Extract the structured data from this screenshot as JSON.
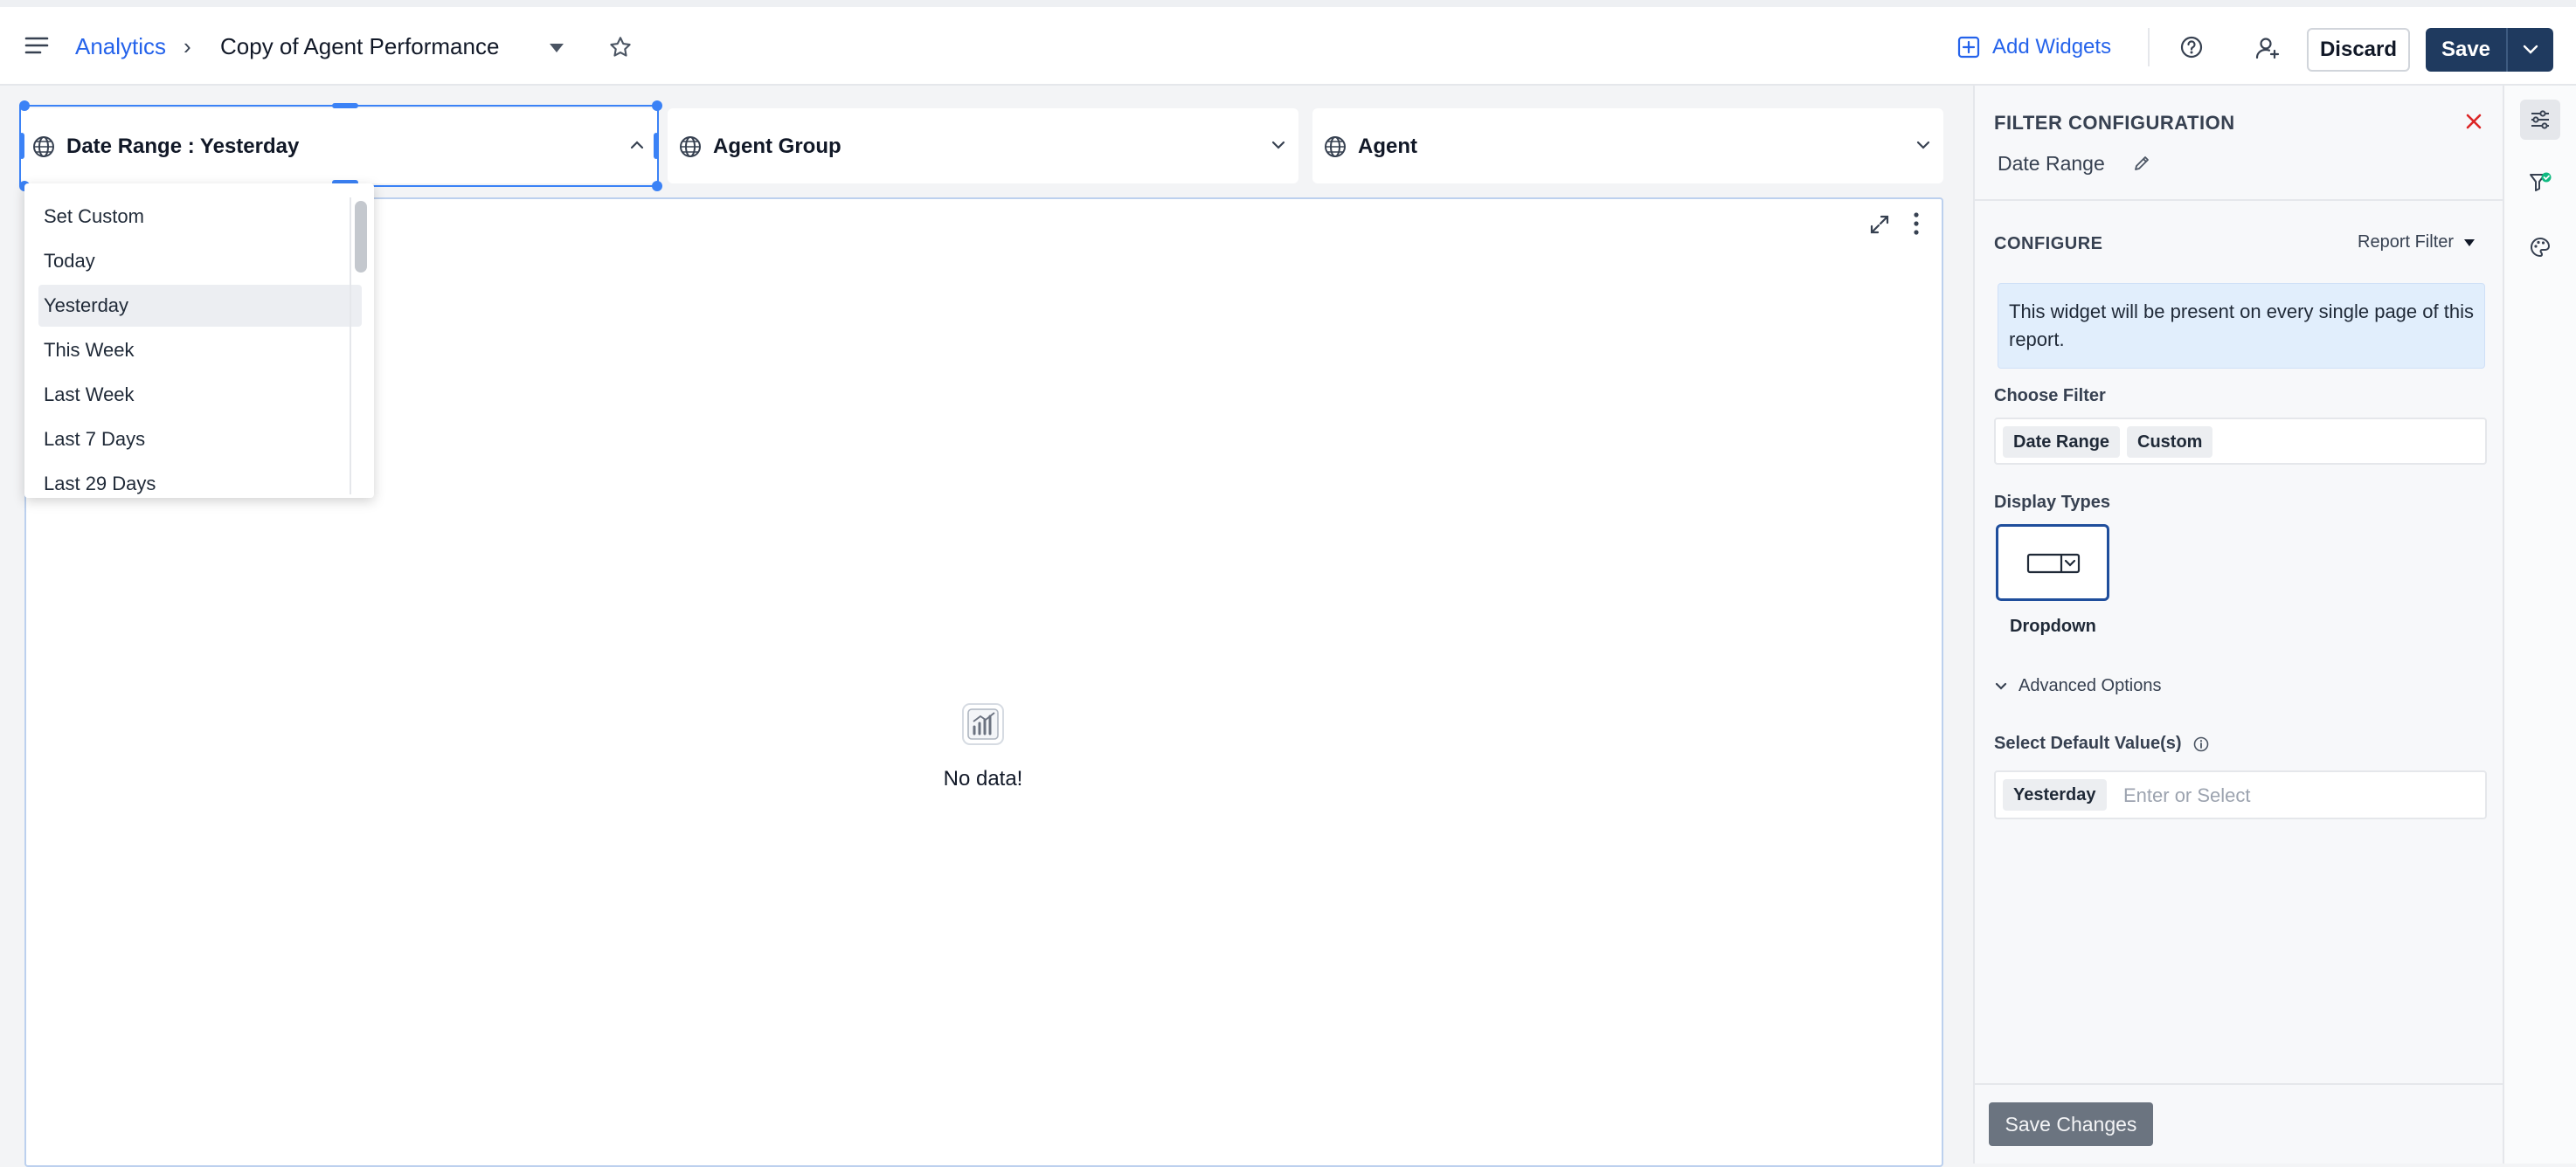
{
  "header": {
    "breadcrumb_root": "Analytics",
    "breadcrumb_separator": "›",
    "report_title": "Copy of Agent  Performance",
    "add_widgets_label": "Add Widgets",
    "discard_label": "Discard",
    "save_label": "Save"
  },
  "filters": [
    {
      "label": "Date Range :  Yesterday"
    },
    {
      "label": "Agent Group"
    },
    {
      "label": "Agent"
    }
  ],
  "date_dropdown": {
    "items": [
      "Set Custom",
      "Today",
      "Yesterday",
      "This Week",
      "Last Week",
      "Last 7 Days",
      "Last 29 Days"
    ],
    "selected": "Yesterday"
  },
  "widget": {
    "empty_text": "No data!"
  },
  "panel": {
    "title": "FILTER CONFIGURATION",
    "filter_name": "Date Range",
    "configure_label": "CONFIGURE",
    "scope_label": "Report Filter",
    "info_text": "This widget will be present on every single page of this report.",
    "choose_filter_label": "Choose Filter",
    "choose_filter_chips": [
      "Date Range",
      "Custom"
    ],
    "display_types_label": "Display Types",
    "display_type_selected": "Dropdown",
    "advanced_label": "Advanced Options",
    "default_value_label": "Select Default Value(s)",
    "default_value_chip": "Yesterday",
    "default_value_placeholder": "Enter or Select",
    "save_changes_label": "Save Changes"
  },
  "colors": {
    "accent": "#2563eb",
    "primary_button": "#1f3a5f",
    "selection": "#3b82f6",
    "close": "#dc2626"
  }
}
